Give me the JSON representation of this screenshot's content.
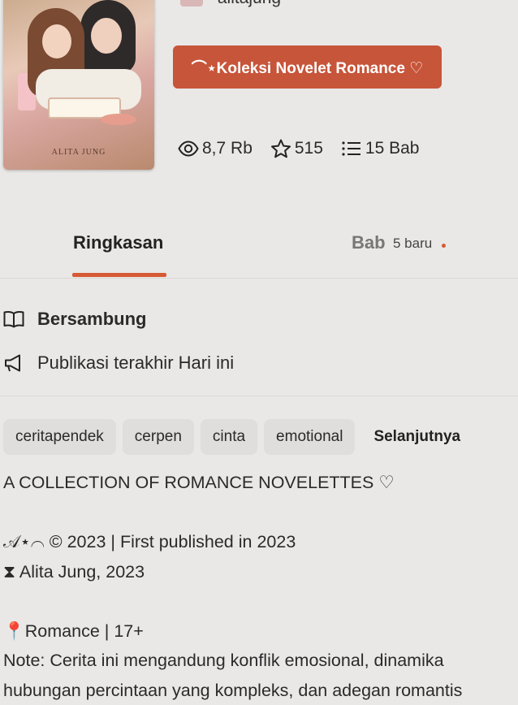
{
  "book": {
    "author_handle": "alitajung",
    "cover_author": "ALITA JUNG",
    "collection_label": "⌒⋆Koleksi Novelet Romance ♡"
  },
  "stats": {
    "views": "8,7 Rb",
    "votes": "515",
    "parts": "15 Bab"
  },
  "tabs": {
    "summary": "Ringkasan",
    "chapters": "Bab",
    "chapters_new": "5 baru"
  },
  "info": {
    "status": "Bersambung",
    "published": "Publikasi terakhir Hari ini"
  },
  "tags": [
    "ceritapendek",
    "cerpen",
    "cinta",
    "emotional"
  ],
  "tags_more": "Selanjutnya",
  "summary": {
    "line1": "A COLLECTION OF ROMANCE NOVELETTES ♡",
    "line2": "",
    "line3": "𝒜⋆⌒ © 2023 | First published in 2023",
    "line4": "⧗ Alita Jung, 2023",
    "line5": "",
    "line6": "📍Romance | 17+",
    "line7": "Note: Cerita ini mengandung konflik emosional, dinamika",
    "line8": "hubungan percintaan yang kompleks, dan adegan romantis"
  }
}
